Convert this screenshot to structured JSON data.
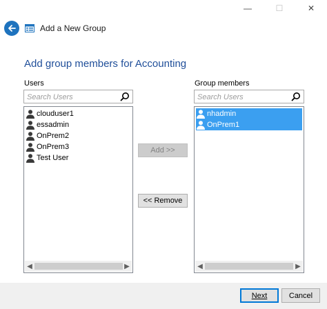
{
  "window": {
    "minimize_glyph": "—",
    "maximize_glyph": "☐",
    "close_glyph": "✕"
  },
  "header": {
    "title": "Add a New Group",
    "back_icon": "back-arrow-icon",
    "app_icon": "group-window-icon",
    "accent": "#1e73be"
  },
  "main": {
    "title": "Add group members for Accounting"
  },
  "users_panel": {
    "label": "Users",
    "search_placeholder": "Search Users",
    "items": [
      {
        "name": "clouduser1"
      },
      {
        "name": "essadmin"
      },
      {
        "name": "OnPrem2"
      },
      {
        "name": "OnPrem3"
      },
      {
        "name": "Test User"
      }
    ]
  },
  "members_panel": {
    "label": "Group members",
    "search_placeholder": "Search Users",
    "items": [
      {
        "name": "nhadmin",
        "selected": true
      },
      {
        "name": "OnPrem1",
        "selected": true
      }
    ]
  },
  "actions": {
    "add_label": "Add >>",
    "remove_label": "<< Remove",
    "add_enabled": false
  },
  "footer": {
    "next_label": "Next",
    "cancel_label": "Cancel"
  },
  "colors": {
    "selection": "#3398ee",
    "title_blue": "#1f4e99"
  }
}
